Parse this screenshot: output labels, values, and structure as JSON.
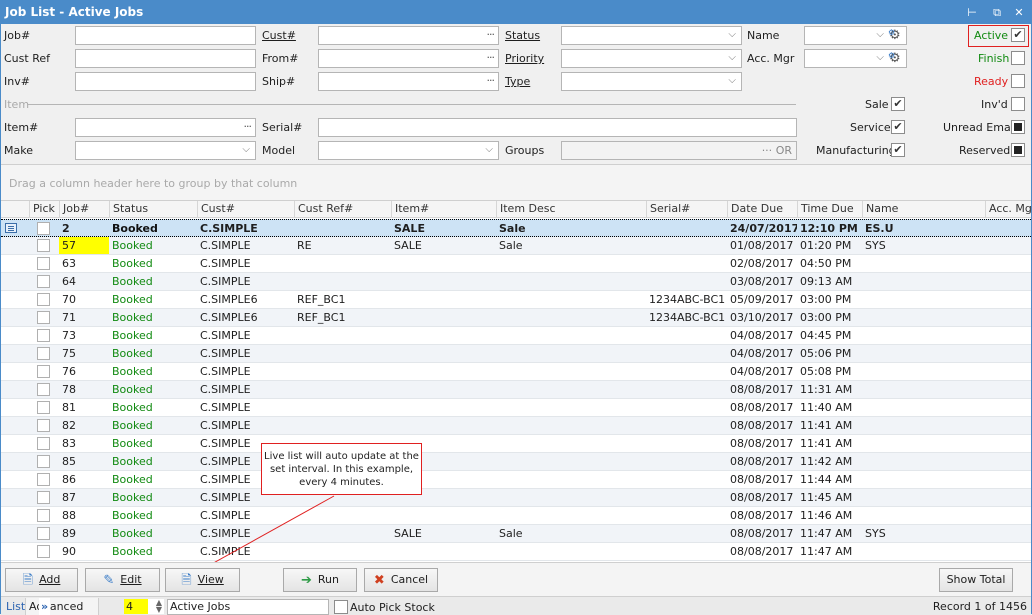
{
  "window": {
    "title": "Job List - Active Jobs",
    "controls": {
      "pin": "⊢",
      "restore": "⧉",
      "close": "✕"
    }
  },
  "filters": {
    "job_label": "Job#",
    "job_value": "",
    "custref_label": "Cust Ref",
    "custref_value": "",
    "inv_label": "Inv#",
    "inv_value": "",
    "cust_label": "Cust#",
    "cust_value": "",
    "from_label": "From#",
    "from_value": "",
    "ship_label": "Ship#",
    "ship_value": "",
    "status_label": "Status",
    "status_value": "",
    "priority_label": "Priority",
    "priority_value": "",
    "type_label": "Type",
    "type_value": "",
    "name_label": "Name",
    "name_value": "",
    "accmgr_label": "Acc. Mgr",
    "accmgr_value": "",
    "item_section_label": "Item",
    "item_label": "Item#",
    "item_value": "",
    "serial_label": "Serial#",
    "serial_value": "",
    "make_label": "Make",
    "make_value": "",
    "model_label": "Model",
    "model_value": "",
    "groups_label": "Groups",
    "groups_value": "",
    "groups_or": "OR",
    "ellipsis": "···",
    "chevron": "⌵"
  },
  "toggles": {
    "active": {
      "label": "Active",
      "checked": true,
      "color": "#118a11"
    },
    "finish": {
      "label": "Finish",
      "checked": false,
      "color": "#118a11"
    },
    "ready": {
      "label": "Ready",
      "checked": false,
      "color": "#e02020"
    },
    "sale": {
      "label": "Sale",
      "checked": true
    },
    "service": {
      "label": "Service",
      "checked": true
    },
    "manufacturing": {
      "label": "Manufacturing",
      "checked": true
    },
    "invd": {
      "label": "Inv'd",
      "checked": false
    },
    "unread_email": {
      "label": "Unread Email",
      "state": "indeterminate"
    },
    "reserved": {
      "label": "Reserved",
      "state": "indeterminate"
    },
    "check_glyph": "✔"
  },
  "grid": {
    "group_hint": "Drag a column header here to group by that column",
    "columns": [
      "",
      "Pick",
      "Job#",
      "Status",
      "Cust#",
      "Cust Ref#",
      "Item#",
      "Item Desc",
      "Serial#",
      "Date Due",
      "Time Due",
      "Name",
      "Acc. Mgr"
    ],
    "rows": [
      {
        "job": "2",
        "status": "Booked",
        "cust": "C.SIMPLE",
        "custref": "",
        "item": "SALE",
        "desc": "Sale",
        "serial": "",
        "date": "24/07/2017",
        "time": "12:10 PM",
        "name": "ES.U",
        "accmgr": "",
        "selected": true
      },
      {
        "job": "57",
        "status": "Booked",
        "cust": "C.SIMPLE",
        "custref": "RE",
        "item": "SALE",
        "desc": "Sale",
        "serial": "",
        "date": "01/08/2017",
        "time": "01:20 PM",
        "name": "SYS",
        "accmgr": "",
        "highlight": true
      },
      {
        "job": "63",
        "status": "Booked",
        "cust": "C.SIMPLE",
        "custref": "",
        "item": "",
        "desc": "",
        "serial": "",
        "date": "02/08/2017",
        "time": "04:50 PM",
        "name": "",
        "accmgr": ""
      },
      {
        "job": "64",
        "status": "Booked",
        "cust": "C.SIMPLE",
        "custref": "",
        "item": "",
        "desc": "",
        "serial": "",
        "date": "03/08/2017",
        "time": "09:13 AM",
        "name": "",
        "accmgr": ""
      },
      {
        "job": "70",
        "status": "Booked",
        "cust": "C.SIMPLE6",
        "custref": "REF_BC1",
        "item": "",
        "desc": "",
        "serial": "1234ABC-BC1",
        "date": "05/09/2017",
        "time": "03:00 PM",
        "name": "",
        "accmgr": ""
      },
      {
        "job": "71",
        "status": "Booked",
        "cust": "C.SIMPLE6",
        "custref": "REF_BC1",
        "item": "",
        "desc": "",
        "serial": "1234ABC-BC1",
        "date": "03/10/2017",
        "time": "03:00 PM",
        "name": "",
        "accmgr": ""
      },
      {
        "job": "73",
        "status": "Booked",
        "cust": "C.SIMPLE",
        "custref": "",
        "item": "",
        "desc": "",
        "serial": "",
        "date": "04/08/2017",
        "time": "04:45 PM",
        "name": "",
        "accmgr": ""
      },
      {
        "job": "75",
        "status": "Booked",
        "cust": "C.SIMPLE",
        "custref": "",
        "item": "",
        "desc": "",
        "serial": "",
        "date": "04/08/2017",
        "time": "05:06 PM",
        "name": "",
        "accmgr": ""
      },
      {
        "job": "76",
        "status": "Booked",
        "cust": "C.SIMPLE",
        "custref": "",
        "item": "",
        "desc": "",
        "serial": "",
        "date": "04/08/2017",
        "time": "05:08 PM",
        "name": "",
        "accmgr": ""
      },
      {
        "job": "78",
        "status": "Booked",
        "cust": "C.SIMPLE",
        "custref": "",
        "item": "",
        "desc": "",
        "serial": "",
        "date": "08/08/2017",
        "time": "11:31 AM",
        "name": "",
        "accmgr": ""
      },
      {
        "job": "81",
        "status": "Booked",
        "cust": "C.SIMPLE",
        "custref": "",
        "item": "",
        "desc": "",
        "serial": "",
        "date": "08/08/2017",
        "time": "11:40 AM",
        "name": "",
        "accmgr": ""
      },
      {
        "job": "82",
        "status": "Booked",
        "cust": "C.SIMPLE",
        "custref": "",
        "item": "",
        "desc": "",
        "serial": "",
        "date": "08/08/2017",
        "time": "11:41 AM",
        "name": "",
        "accmgr": ""
      },
      {
        "job": "83",
        "status": "Booked",
        "cust": "C.SIMPLE",
        "custref": "",
        "item": "",
        "desc": "",
        "serial": "",
        "date": "08/08/2017",
        "time": "11:41 AM",
        "name": "",
        "accmgr": ""
      },
      {
        "job": "85",
        "status": "Booked",
        "cust": "C.SIMPLE",
        "custref": "",
        "item": "",
        "desc": "",
        "serial": "",
        "date": "08/08/2017",
        "time": "11:42 AM",
        "name": "",
        "accmgr": ""
      },
      {
        "job": "86",
        "status": "Booked",
        "cust": "C.SIMPLE",
        "custref": "",
        "item": "",
        "desc": "",
        "serial": "",
        "date": "08/08/2017",
        "time": "11:44 AM",
        "name": "",
        "accmgr": ""
      },
      {
        "job": "87",
        "status": "Booked",
        "cust": "C.SIMPLE",
        "custref": "",
        "item": "",
        "desc": "",
        "serial": "",
        "date": "08/08/2017",
        "time": "11:45 AM",
        "name": "",
        "accmgr": ""
      },
      {
        "job": "88",
        "status": "Booked",
        "cust": "C.SIMPLE",
        "custref": "",
        "item": "",
        "desc": "",
        "serial": "",
        "date": "08/08/2017",
        "time": "11:46 AM",
        "name": "",
        "accmgr": ""
      },
      {
        "job": "89",
        "status": "Booked",
        "cust": "C.SIMPLE",
        "custref": "",
        "item": "SALE",
        "desc": "Sale",
        "serial": "",
        "date": "08/08/2017",
        "time": "11:47 AM",
        "name": "SYS",
        "accmgr": ""
      },
      {
        "job": "90",
        "status": "Booked",
        "cust": "C.SIMPLE",
        "custref": "",
        "item": "",
        "desc": "",
        "serial": "",
        "date": "08/08/2017",
        "time": "11:47 AM",
        "name": "",
        "accmgr": ""
      }
    ]
  },
  "callout": {
    "text": "Live list will auto update at the set interval. In this example, every 4 minutes."
  },
  "buttons": {
    "add": "Add",
    "edit": "Edit",
    "view": "View",
    "run": "Run",
    "cancel": "Cancel",
    "show_total": "Show Total"
  },
  "statusbar": {
    "tab_list": "List",
    "tab_advanced": "Advanced List",
    "overflow": "»",
    "interval_value": "4",
    "list_name": "Active Jobs",
    "auto_pick_label": "Auto Pick Stock",
    "auto_pick_checked": false,
    "record_text": "Record 1 of 1456"
  }
}
